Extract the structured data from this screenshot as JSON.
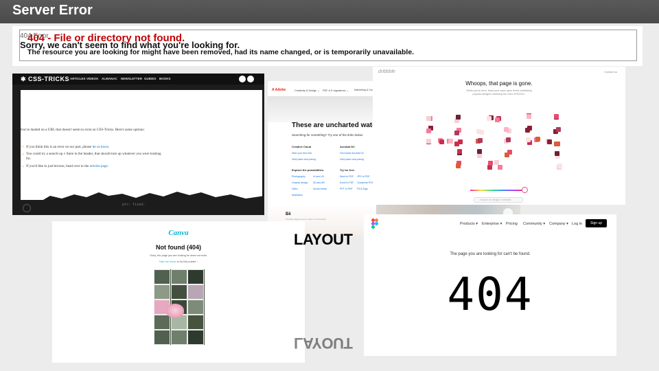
{
  "header": {
    "title": "Server Error"
  },
  "iis": {
    "heading": "404 - File or directory not found.",
    "message": "The resource you are looking for might have been removed, had its name changed, or is temporarily unavailable."
  },
  "csstricks": {
    "logo": "✱ CSS-TRICKS",
    "nav": [
      "ARTICLES",
      "VIDEOS",
      "ALMANAC",
      "NEWSLETTER",
      "GUIDES",
      "BOOKS"
    ],
    "label": "404 Error",
    "title": "Sorry, we can't seem to find what you're looking for.",
    "intro": "You've landed on a URL that doesn't seem to exist on CSS-Tricks. Here's some options:",
    "bullets": [
      {
        "text": "If you think this is an error on our part, please ",
        "link": "let us know."
      },
      {
        "text": "You could try a search-up ⌕ there in the header, that should turn up whatever you were looking for.",
        "link": ""
      },
      {
        "text": "If you'd like to just browse, head over to the ",
        "link": "articles page."
      }
    ]
  },
  "adobe": {
    "logo": "A Adobe",
    "nav": [
      "Creativity & Design ⌄",
      "PDF & E-signatures ⌄",
      "Marketing & Com"
    ],
    "title": "These are uncharted waters.",
    "subtitle": "Searching for something? Try one of the links below",
    "col1_head": "Creative Cloud",
    "col1_links": [
      "Start your free trial",
      "View plans and pricing"
    ],
    "col2_head": "Acrobat DC",
    "col2_links": [
      "Get Adobe Acrobat DC",
      "View plans and pricing"
    ],
    "col3_head": "Explore the possibilities.",
    "col3_links": [
      "Photography",
      "Graphic design",
      "Video",
      "Illustration"
    ],
    "col3b_links": [
      "UI and UX",
      "3D and AR",
      "Social media"
    ],
    "col4_head": "Try for free.",
    "col4_links": [
      "Word to PDF",
      "Excel to PDF",
      "PPT to PDF"
    ],
    "col4b_links": [
      "JPG to PDF",
      "Compress PDF",
      "Fill & Sign"
    ],
    "foot_logo": "Bē",
    "foot_line": "The Best Region Hop to Hope On Fotoshots"
  },
  "dribbble": {
    "logo": "dribbble",
    "contact": "Contact us",
    "title": "Whoops, that page is gone.",
    "body_1": "While you're here, feast your eyes upon these tantalizing",
    "body_2": "popular designs matching the color #FE004C.",
    "search_placeholder": "⌕ Search for design in dribbble"
  },
  "canva": {
    "logo": "Canva",
    "title": "Not found (404)",
    "subtitle": "Sorry, the page you are looking for does not exist.",
    "link_home": "Take me home",
    "links_tail": " or try this puzzle ↓"
  },
  "layout_label": "LAYOUT",
  "figma": {
    "nav": [
      "Products ▾",
      "Enterprise ▾",
      "Pricing",
      "Community ▾",
      "Company ▾",
      "Log in"
    ],
    "signup": "Sign up",
    "message": "The page you are looking for can't be found.",
    "big": "404"
  },
  "colors": {
    "iis_red": "#c00000",
    "dribbble_pink": "#ea4c89",
    "canva_teal": "#10b4c8",
    "adobe_red": "#e1251b",
    "csst_orange": "#e8711c"
  }
}
